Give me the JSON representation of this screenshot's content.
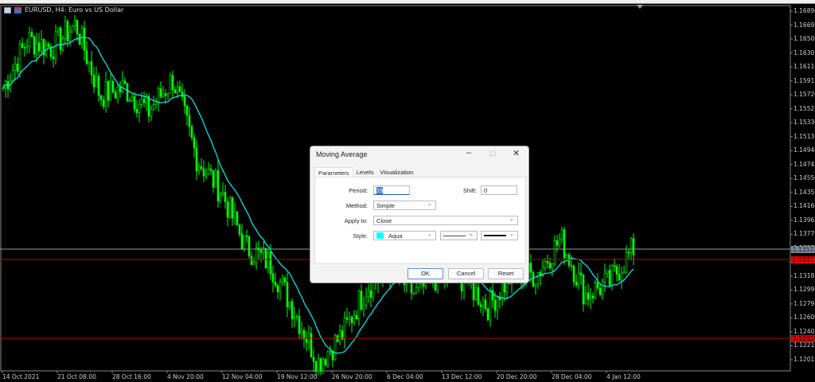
{
  "window": {
    "symbol_title": "EURUSD, H4:  Euro vs US Dollar"
  },
  "colors": {
    "candle": "#00ff00",
    "ma": "#00e5e5",
    "bid_line": "#8a9aa8",
    "red_line": "#c00000",
    "tag_red": "#ff0000"
  },
  "price_axis": {
    "labels": [
      "1.16890",
      "1.16695",
      "1.16500",
      "1.16305",
      "1.16110",
      "1.15915",
      "1.15720",
      "1.15525",
      "1.15330",
      "1.15135",
      "1.14940",
      "1.14745",
      "1.14550",
      "1.14355",
      "1.14160",
      "1.13965",
      "1.13770",
      "1.13575",
      "1.13380",
      "1.13185",
      "1.12990",
      "1.12795",
      "1.12600",
      "1.12405",
      "1.12210",
      "1.12015"
    ],
    "current_price": "1.13572",
    "red_level_1": "1.13413",
    "red_level_2": "1.12318"
  },
  "time_axis": {
    "labels": [
      "14 Oct 2021",
      "21 Oct 08:00",
      "28 Oct 16:00",
      "4 Nov 20:00",
      "12 Nov 04:00",
      "19 Nov 12:00",
      "26 Nov 20:00",
      "6 Dec 04:00",
      "13 Dec 12:00",
      "20 Dec 20:00",
      "28 Dec 04:00",
      "4 Jan 12:00"
    ]
  },
  "chart_data": {
    "type": "candlestick",
    "price_path": [
      1.1582,
      1.1649,
      1.1638,
      1.1671,
      1.1571,
      1.1582,
      1.1549,
      1.1594,
      1.1482,
      1.1437,
      1.1359,
      1.1337,
      1.1271,
      1.1198,
      1.1237,
      1.1304,
      1.1326,
      1.1293,
      1.1321,
      1.1315,
      1.1276,
      1.1321,
      1.1321,
      1.1371,
      1.1293,
      1.131,
      1.1357
    ],
    "ma_period": 15
  },
  "dialog": {
    "title": "Moving Average",
    "tabs": [
      "Parameters",
      "Levels",
      "Visualization"
    ],
    "period_label": "Period:",
    "period_value": "15",
    "shift_label": "Shift:",
    "shift_value": "0",
    "method_label": "Method:",
    "method_value": "Simple",
    "apply_label": "Apply to:",
    "apply_value": "Close",
    "style_label": "Style:",
    "style_color": "Aqua",
    "ok": "OK",
    "cancel": "Cancel",
    "reset": "Reset"
  }
}
